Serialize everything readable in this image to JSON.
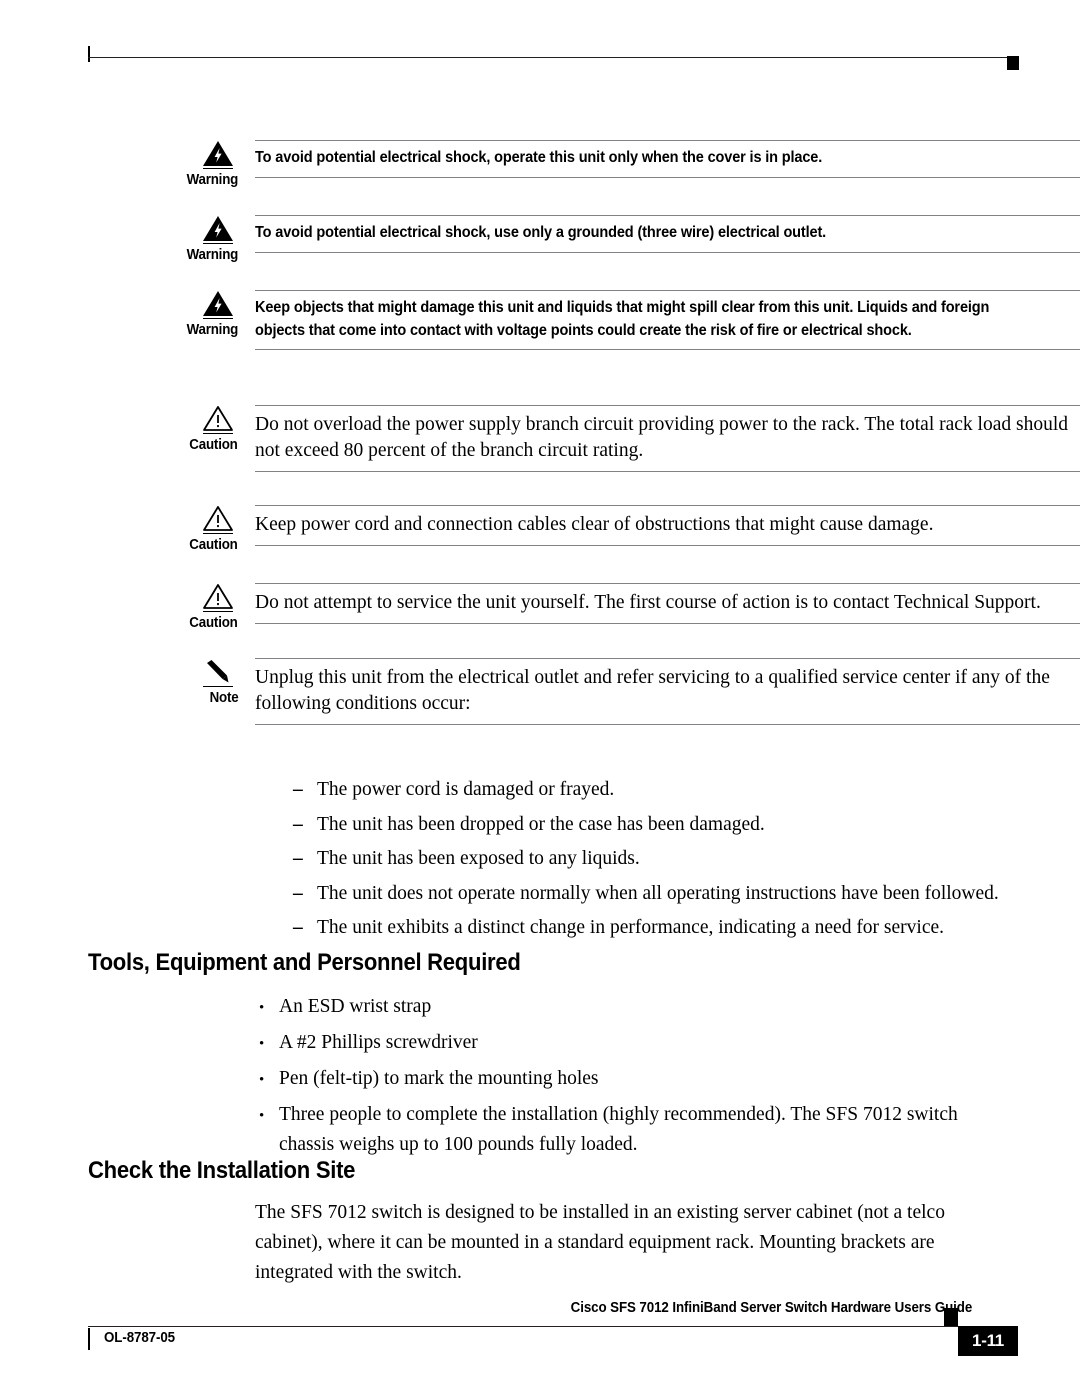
{
  "header": {
    "rule_tick": "crop-tick",
    "rule_square": "crop-square"
  },
  "admonitions": [
    {
      "type": "warning",
      "icon": "warning-lightning-triangle-icon",
      "label": "Warning",
      "text": "To avoid potential electrical shock, operate this unit only when the cover is in place."
    },
    {
      "type": "warning",
      "icon": "warning-lightning-triangle-icon",
      "label": "Warning",
      "text": "To avoid potential electrical shock, use only a grounded (three wire) electrical outlet."
    },
    {
      "type": "warning",
      "icon": "warning-lightning-triangle-icon",
      "label": "Warning",
      "text": "Keep objects that might damage this unit and liquids that might spill clear from this unit. Liquids and foreign objects that come into contact with voltage points could create the risk of fire or electrical shock."
    },
    {
      "type": "caution",
      "icon": "caution-exclamation-triangle-icon",
      "label": "Caution",
      "text": "Do not overload the power supply branch circuit providing power to the rack. The total rack load should not exceed 80 percent of the branch circuit rating."
    },
    {
      "type": "caution",
      "icon": "caution-exclamation-triangle-icon",
      "label": "Caution",
      "text": "Keep power cord and connection cables clear of obstructions that might cause damage."
    },
    {
      "type": "caution",
      "icon": "caution-exclamation-triangle-icon",
      "label": "Caution",
      "text": "Do not attempt to service the unit yourself. The first course of action is to contact Technical Support."
    },
    {
      "type": "note",
      "icon": "note-pencil-icon",
      "label": "Note",
      "text": "Unplug this unit from the electrical outlet and refer servicing to a qualified service center if any of the following conditions occur:"
    }
  ],
  "conditions_list": {
    "marker": "–",
    "items": [
      "The power cord is damaged or frayed.",
      "The unit has been dropped or the case has been damaged.",
      "The unit has been exposed to any liquids.",
      "The unit does not operate normally when all operating instructions have been followed.",
      "The unit exhibits a distinct change in performance, indicating a need for service."
    ]
  },
  "sections": [
    {
      "heading": "Tools, Equipment and Personnel Required",
      "bullet_marker": "•",
      "bullets": [
        "An ESD wrist strap",
        "A #2 Phillips screwdriver",
        "Pen (felt-tip) to mark the mounting holes",
        "Three people to complete the installation (highly recommended). The SFS 7012 switch chassis weighs up to 100 pounds fully loaded."
      ]
    },
    {
      "heading": "Check the Installation Site",
      "paragraph": "The SFS 7012 switch is designed to be installed in an existing server cabinet (not a telco cabinet), where it can be mounted in a standard equipment rack. Mounting brackets are integrated with the switch."
    }
  ],
  "footer": {
    "doc_id": "OL-8787-05",
    "title": "Cisco SFS 7012 InfiniBand Server Switch Hardware Users Guide",
    "page_number": "1-11"
  },
  "colors": {
    "text": "#000000",
    "rule": "#808285",
    "crop_rule": "#231f20",
    "page_box_bg": "#000000",
    "page_box_fg": "#ffffff"
  }
}
